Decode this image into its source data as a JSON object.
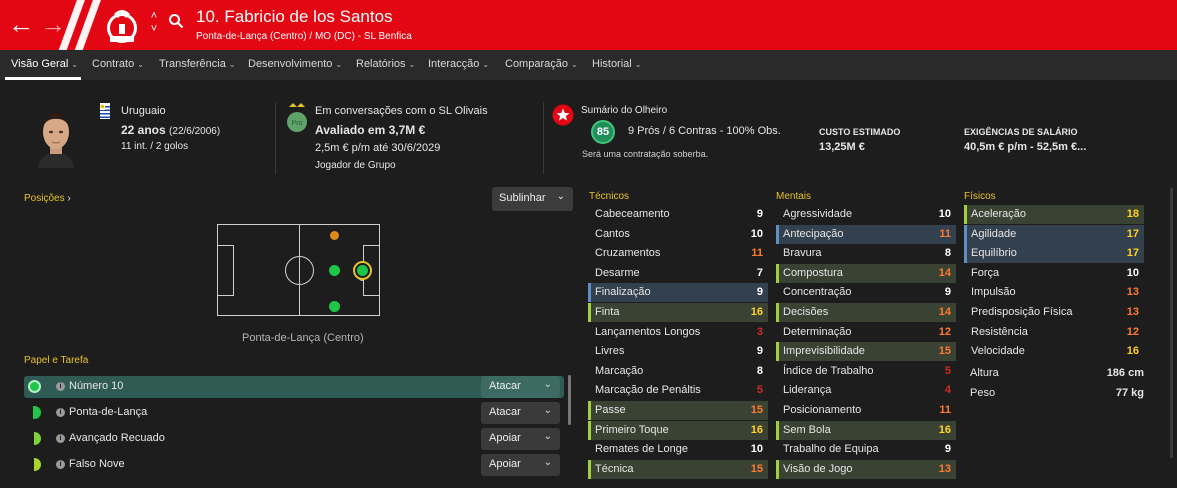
{
  "header": {
    "player_title": "10. Fabricio de los Santos",
    "subtitle": "Ponta-de-Lança (Centro) / MO (DC) - SL Benfica",
    "back_icon": "back-arrow-icon",
    "forward_icon": "forward-arrow-icon",
    "search_icon": "search-icon",
    "colors": {
      "brand_red": "#e30613"
    }
  },
  "nav": {
    "tabs": [
      "Visão Geral",
      "Contrato",
      "Transferência",
      "Desenvolvimento",
      "Relatórios",
      "Interacção",
      "Comparação",
      "Historial"
    ],
    "active": "Visão Geral"
  },
  "profile": {
    "nationality": "Uruguaio",
    "age": "22 anos",
    "dob": "(22/6/2006)",
    "caps": "11 int. / 2 golos"
  },
  "transfer": {
    "club_badge_text": "Pro",
    "status": "Em conversações com o SL Olivais",
    "value": "Avaliado em 3,7M €",
    "contract": "2,5m € p/m até 30/6/2029",
    "squad_status": "Jogador de Grupo"
  },
  "scout": {
    "title": "Sumário do Olheiro",
    "rating": "85",
    "summary": "9 Prós / 6 Contras - 100% Obs.",
    "verdict": "Será uma contratação soberba.",
    "cost_label": "CUSTO ESTIMADO",
    "cost_value": "13,25M €",
    "wage_label": "EXIGÊNCIAS DE SALÁRIO",
    "wage_value": "40,5m € p/m - 52,5m €..."
  },
  "positions": {
    "label": "Posições",
    "highlight_button": "Sublinhar",
    "position_caption": "Ponta-de-Lança (Centro)"
  },
  "roles": {
    "label": "Papel e Tarefa",
    "items": [
      {
        "name": "Número 10",
        "duty": "Atacar",
        "selected": true
      },
      {
        "name": "Ponta-de-Lança",
        "duty": "Atacar",
        "selected": false
      },
      {
        "name": "Avançado Recuado",
        "duty": "Apoiar",
        "selected": false
      },
      {
        "name": "Falso Nove",
        "duty": "Apoiar",
        "selected": false
      }
    ]
  },
  "attributes": {
    "technical_label": "Técnicos",
    "mental_label": "Mentais",
    "physical_label": "Físicos",
    "technical": [
      {
        "name": "Cabeceamento",
        "value": "9"
      },
      {
        "name": "Cantos",
        "value": "10"
      },
      {
        "name": "Cruzamentos",
        "value": "11"
      },
      {
        "name": "Desarme",
        "value": "7"
      },
      {
        "name": "Finalização",
        "value": "9"
      },
      {
        "name": "Finta",
        "value": "16"
      },
      {
        "name": "Lançamentos Longos",
        "value": "3"
      },
      {
        "name": "Livres",
        "value": "9"
      },
      {
        "name": "Marcação",
        "value": "8"
      },
      {
        "name": "Marcação de Penáltis",
        "value": "5"
      },
      {
        "name": "Passe",
        "value": "15"
      },
      {
        "name": "Primeiro Toque",
        "value": "16"
      },
      {
        "name": "Remates de Longe",
        "value": "10"
      },
      {
        "name": "Técnica",
        "value": "15"
      }
    ],
    "mental": [
      {
        "name": "Agressividade",
        "value": "10"
      },
      {
        "name": "Antecipação",
        "value": "11"
      },
      {
        "name": "Bravura",
        "value": "8"
      },
      {
        "name": "Compostura",
        "value": "14"
      },
      {
        "name": "Concentração",
        "value": "9"
      },
      {
        "name": "Decisões",
        "value": "14"
      },
      {
        "name": "Determinação",
        "value": "12"
      },
      {
        "name": "Imprevisibilidade",
        "value": "15"
      },
      {
        "name": "Índice de Trabalho",
        "value": "5"
      },
      {
        "name": "Liderança",
        "value": "4"
      },
      {
        "name": "Posicionamento",
        "value": "11"
      },
      {
        "name": "Sem Bola",
        "value": "16"
      },
      {
        "name": "Trabalho de Equipa",
        "value": "9"
      },
      {
        "name": "Visão de Jogo",
        "value": "13"
      }
    ],
    "physical": [
      {
        "name": "Aceleração",
        "value": "18"
      },
      {
        "name": "Agilidade",
        "value": "17"
      },
      {
        "name": "Equilíbrio",
        "value": "17"
      },
      {
        "name": "Força",
        "value": "10"
      },
      {
        "name": "Impulsão",
        "value": "13"
      },
      {
        "name": "Predisposição Física",
        "value": "13"
      },
      {
        "name": "Resistência",
        "value": "12"
      },
      {
        "name": "Velocidade",
        "value": "16"
      }
    ],
    "height_label": "Altura",
    "height_value": "186 cm",
    "weight_label": "Peso",
    "weight_value": "77 kg"
  }
}
